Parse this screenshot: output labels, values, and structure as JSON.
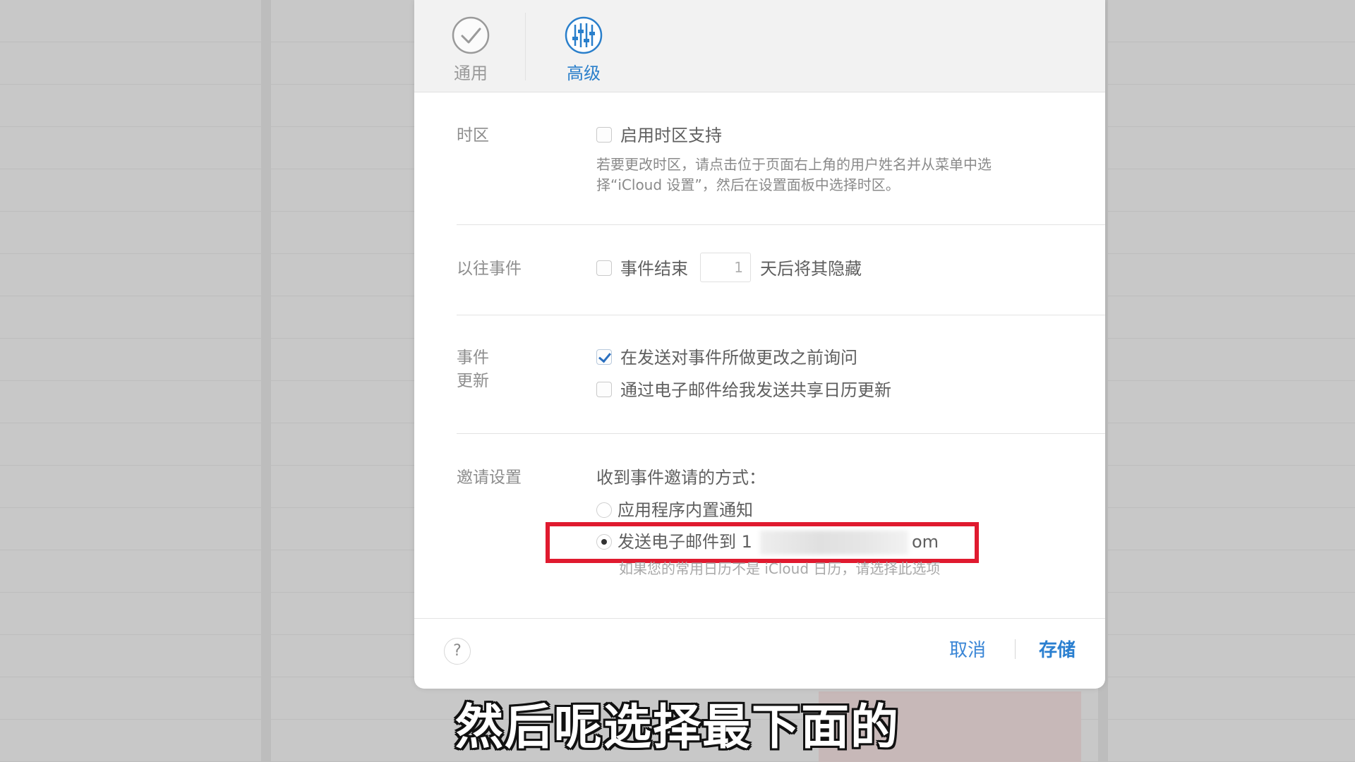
{
  "toolbar": {
    "tabs": [
      {
        "label": "通用",
        "icon": "checkmark-circle-icon"
      },
      {
        "label": "高级",
        "icon": "sliders-icon"
      }
    ],
    "active_color": "#2a7fcb"
  },
  "timezone": {
    "section_label": "时区",
    "checkbox_label": "启用时区支持",
    "checked": false,
    "note_line1": "若要更改时区，请点击位于页面右上角的用户姓名并从菜单中选",
    "note_line2": "择“iCloud 设置”，然后在设置面板中选择时区。"
  },
  "past_events": {
    "section_label": "以往事件",
    "checkbox_label": "事件结束",
    "checked": false,
    "days_value": "1",
    "suffix": "天后将其隐藏"
  },
  "event_updates": {
    "section_label_line1": "事件",
    "section_label_line2": "更新",
    "options": [
      {
        "label": "在发送对事件所做更改之前询问",
        "checked": true
      },
      {
        "label": "通过电子邮件给我发送共享日历更新",
        "checked": false
      }
    ]
  },
  "invitations": {
    "section_label": "邀请设置",
    "prompt": "收到事件邀请的方式：",
    "options": [
      {
        "label": "应用程序内置通知",
        "selected": false
      },
      {
        "label_prefix": "发送电子邮件到 1",
        "label_suffix": "om",
        "selected": true
      }
    ],
    "note": "如果您的常用日历不是 iCloud 日历，请选择此选项"
  },
  "footer": {
    "help_label": "?",
    "cancel_label": "取消",
    "save_label": "存储"
  },
  "caption": "然后呢选择最下面的",
  "colors": {
    "highlight": "#e01a2f",
    "accent": "#2a7fd0"
  }
}
